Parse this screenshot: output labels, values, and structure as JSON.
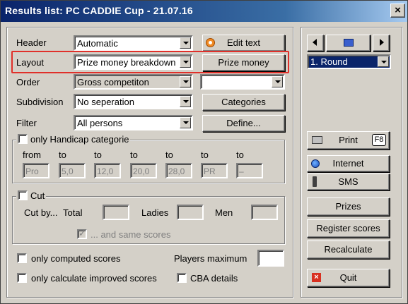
{
  "window": {
    "title": "Results list: PC CADDIE Cup - 21.07.16",
    "close_glyph": "×"
  },
  "rows": {
    "header": {
      "label": "Header",
      "value": "Automatic"
    },
    "layout": {
      "label": "Layout",
      "value": "Prize money breakdown"
    },
    "order": {
      "label": "Order",
      "value": "Gross competiton"
    },
    "subdivision": {
      "label": "Subdivision",
      "value": "No seperation"
    },
    "filter": {
      "label": "Filter",
      "value": "All persons"
    }
  },
  "buttons": {
    "edit_text": "Edit text",
    "prize_money": "Prize money",
    "categories": "Categories",
    "define": "Define...",
    "print": "Print",
    "print_key": "F8",
    "internet": "Internet",
    "sms": "SMS",
    "prizes": "Prizes",
    "register_scores": "Register scores",
    "recalculate": "Recalculate",
    "quit": "Quit"
  },
  "round_select": {
    "value": "1. Round"
  },
  "handicap": {
    "title": "only Handicap categorie",
    "from_label": "from",
    "to_label": "to",
    "values": [
      "Pro",
      "5,0",
      "12,0",
      "20,0",
      "28,0",
      "PR",
      "–"
    ]
  },
  "cut": {
    "title": "Cut",
    "cut_by": "Cut by...",
    "total": "Total",
    "ladies": "Ladies",
    "men": "Men",
    "same_scores": "... and same scores"
  },
  "options": {
    "computed_scores": "only computed scores",
    "improved_scores": "only calculate improved scores",
    "players_max": "Players maximum",
    "cba": "CBA details"
  },
  "colors": {
    "title_start": "#0a246a",
    "title_end": "#a6caf0",
    "highlight": "#0a246a",
    "annotation": "#e0302a"
  }
}
